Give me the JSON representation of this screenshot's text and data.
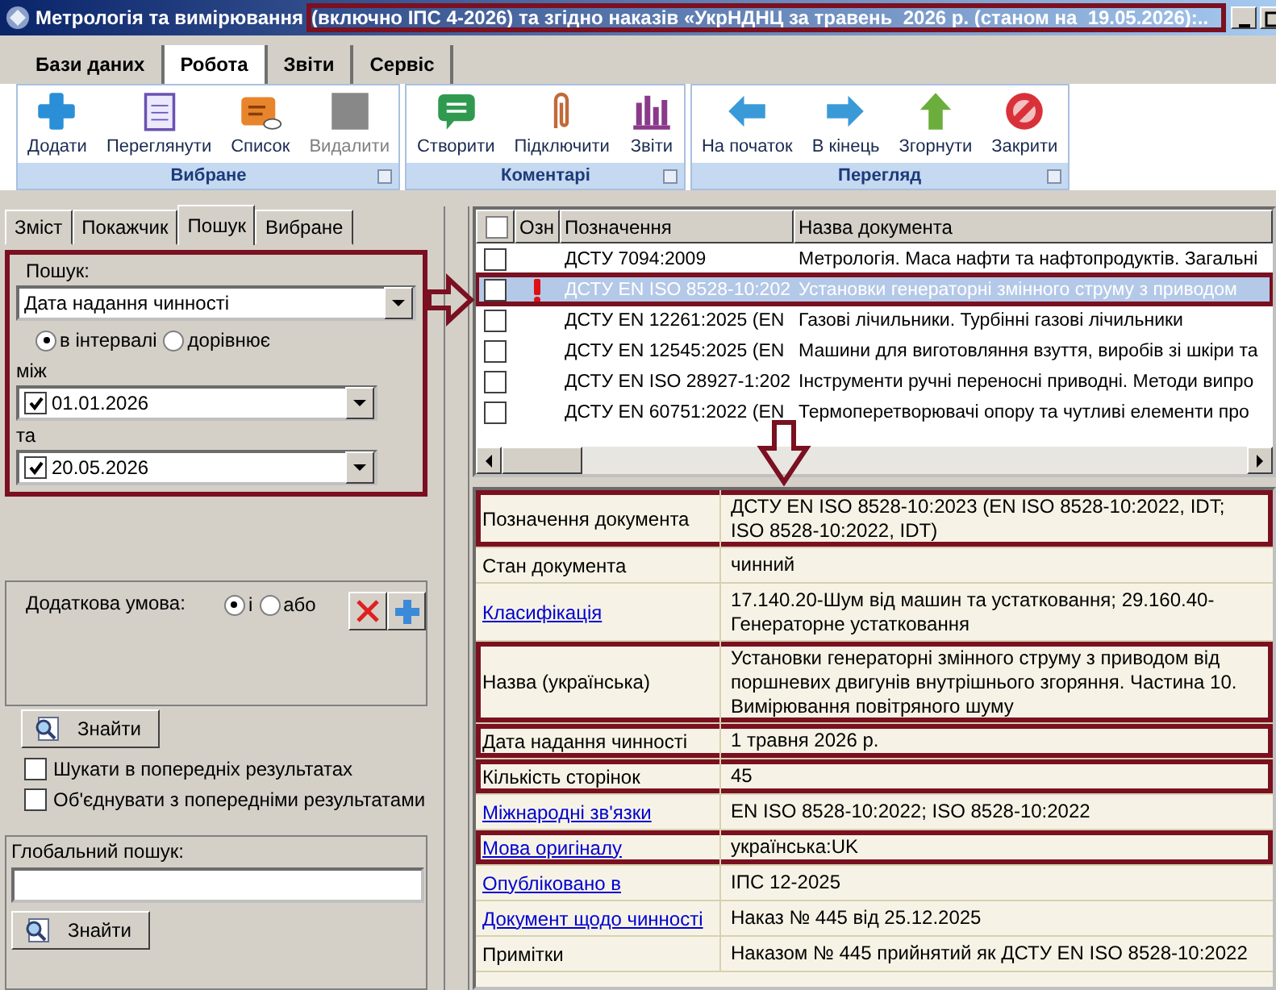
{
  "window": {
    "title": "Метрологія та вимірювання",
    "subtitle": "(включно ІПС 4-2026) та згідно наказів «УкрНДНЦ за травень  2026 р. (станом на  19.05.2026):..",
    "subtitle_highlighted": true
  },
  "ribbon": {
    "tabs": [
      {
        "label": "Бази даних",
        "selected": false
      },
      {
        "label": "Робота",
        "selected": true
      },
      {
        "label": "Звіти",
        "selected": false
      },
      {
        "label": "Сервіс",
        "selected": false
      }
    ],
    "groups": [
      {
        "title": "Вибране",
        "buttons": [
          {
            "label": "Додати",
            "disabled": false
          },
          {
            "label": "Переглянути",
            "disabled": false
          },
          {
            "label": "Список",
            "disabled": false
          },
          {
            "label": "Видалити",
            "disabled": true
          }
        ]
      },
      {
        "title": "Коментарі",
        "buttons": [
          {
            "label": "Створити",
            "disabled": false
          },
          {
            "label": "Підключити",
            "disabled": false
          },
          {
            "label": "Звіти",
            "disabled": false
          }
        ]
      },
      {
        "title": "Перегляд",
        "buttons": [
          {
            "label": "На початок",
            "disabled": false
          },
          {
            "label": "В кінець",
            "disabled": false
          },
          {
            "label": "Згорнути",
            "disabled": false
          },
          {
            "label": "Закрити",
            "disabled": false
          }
        ]
      }
    ]
  },
  "left_panel": {
    "tabs": [
      {
        "label": "Зміст",
        "selected": false
      },
      {
        "label": "Покажчик",
        "selected": false
      },
      {
        "label": "Пошук",
        "selected": true
      },
      {
        "label": "Вибране",
        "selected": false
      }
    ],
    "search": {
      "highlighted": true,
      "label": "Пошук:",
      "field": "Дата надання чинності",
      "modes": [
        {
          "label": "в інтервалі",
          "selected": true
        },
        {
          "label": "дорівнює",
          "selected": false
        }
      ],
      "from_label": "між",
      "from": {
        "checked": true,
        "value": "01.01.2026"
      },
      "to_label": "та",
      "to": {
        "checked": true,
        "value": "20.05.2026"
      }
    },
    "extra_condition": {
      "label": "Додаткова умова:",
      "options": [
        {
          "label": "і",
          "selected": true
        },
        {
          "label": "або",
          "selected": false
        }
      ]
    },
    "find_button": "Знайти",
    "options": [
      {
        "label": "Шукати в попередніх результатах",
        "checked": false
      },
      {
        "label": "Об'єднувати з попередніми результатами",
        "checked": false
      }
    ],
    "global_search": {
      "label": "Глобальний пошук:",
      "button": "Знайти"
    }
  },
  "table": {
    "select_all_checked": false,
    "columns": [
      "Озн",
      "Позначення",
      "Назва документа"
    ],
    "rows": [
      {
        "checked": false,
        "flagged": false,
        "selected": false,
        "highlighted": false,
        "designation": "ДСТУ 7094:2009",
        "name": "Метрологія. Маса нафти та нафтопродуктів. Загальні"
      },
      {
        "checked": false,
        "flagged": true,
        "selected": true,
        "highlighted": true,
        "designation": "ДСТУ EN ISO 8528-10:202",
        "name": "Установки генераторні змінного струму з приводом"
      },
      {
        "checked": false,
        "flagged": false,
        "selected": false,
        "highlighted": false,
        "designation": "ДСТУ EN 12261:2025 (EN",
        "name": "Газові лічильники. Турбінні газові лічильники"
      },
      {
        "checked": false,
        "flagged": false,
        "selected": false,
        "highlighted": false,
        "designation": "ДСТУ EN 12545:2025 (EN",
        "name": "Машини для виготовляння взуття, виробів зі шкіри та"
      },
      {
        "checked": false,
        "flagged": false,
        "selected": false,
        "highlighted": false,
        "designation": "ДСТУ EN ISO 28927-1:202",
        "name": "Інструменти ручні переносні приводні. Методи випро"
      },
      {
        "checked": false,
        "flagged": false,
        "selected": false,
        "highlighted": false,
        "designation": "ДСТУ EN 60751:2022 (EN",
        "name": "Термоперетворювачі опору та чутливі елементи про"
      }
    ]
  },
  "details": [
    {
      "label": "Позначення документа",
      "link": false,
      "highlighted": true,
      "value": "ДСТУ EN ISO 8528-10:2023 (EN ISO 8528-10:2022, IDT; ISO 8528-10:2022, IDT)"
    },
    {
      "label": "Стан документа",
      "link": false,
      "highlighted": false,
      "value": "чинний"
    },
    {
      "label": "Класифікація",
      "link": true,
      "highlighted": false,
      "value": "17.140.20-Шум від машин та устатковання; 29.160.40-Генераторне устатковання"
    },
    {
      "label": "Назва (українська)",
      "link": false,
      "highlighted": true,
      "value": "Установки генераторні змінного струму з приводом від поршневих двигунів внутрішнього згоряння. Частина 10. Вимірювання повітряного шуму"
    },
    {
      "label": "Дата надання чинності",
      "link": false,
      "highlighted": true,
      "value": "1 травня 2026 р."
    },
    {
      "label": "Кількість сторінок",
      "link": false,
      "highlighted": true,
      "value": "45"
    },
    {
      "label": "Міжнародні зв'язки",
      "link": true,
      "highlighted": false,
      "value": "EN ISO 8528-10:2022; ISO 8528-10:2022"
    },
    {
      "label": "Мова оригіналу",
      "link": true,
      "highlighted": true,
      "value": "українська:UK"
    },
    {
      "label": "Опубліковано в",
      "link": true,
      "highlighted": false,
      "value": "ІПС 12-2025"
    },
    {
      "label": "Документ щодо чинності",
      "link": true,
      "highlighted": false,
      "value": "Наказ № 445 від 25.12.2025"
    },
    {
      "label": "Примітки",
      "link": false,
      "highlighted": false,
      "value": "Наказом № 445 прийнятий як ДСТУ EN ISO 8528-10:2022"
    }
  ]
}
